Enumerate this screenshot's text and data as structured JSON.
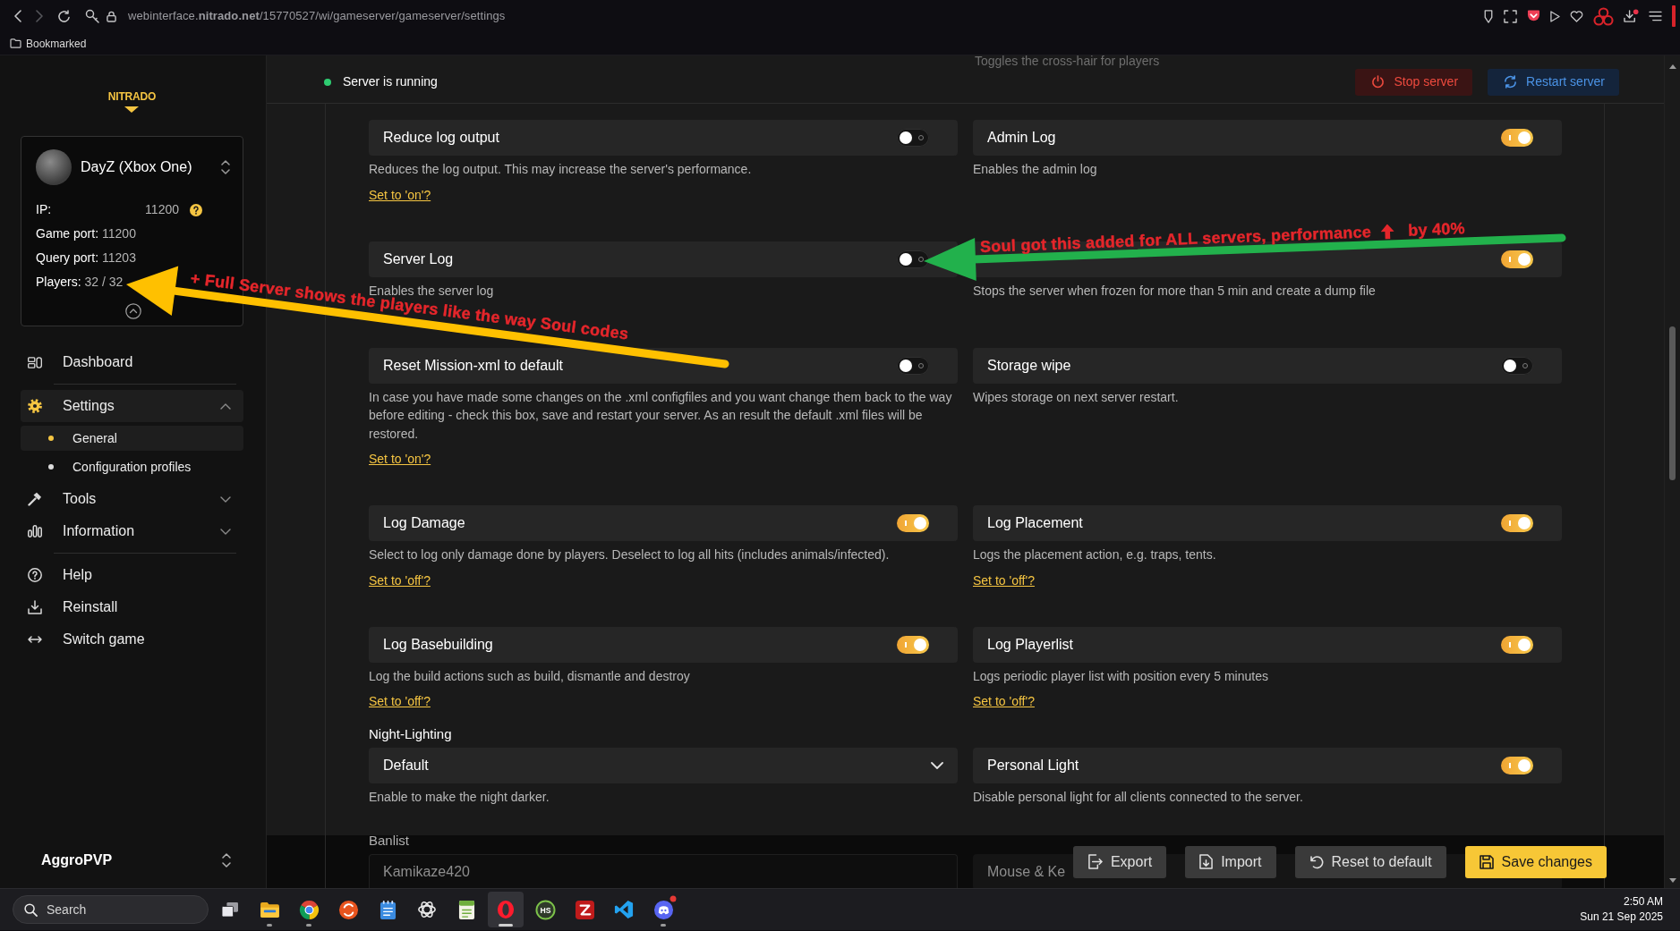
{
  "browser": {
    "url": "webinterface.**nitrado.net**/15770527/wi/gameserver/gameserver/settings",
    "bookmarks": [
      "Bookmarked"
    ]
  },
  "sidebar": {
    "logo": "NITRADO",
    "server": {
      "name": "DayZ (Xbox One)",
      "details": [
        {
          "kind": "help",
          "label": "IP:",
          "value": "11200"
        },
        {
          "kind": "plain",
          "label": "Game port:",
          "value": "11200"
        },
        {
          "kind": "plain",
          "label": "Query port:",
          "value": "11203"
        },
        {
          "kind": "plain",
          "label": "Players:",
          "value": "32 / 32"
        }
      ]
    },
    "nav": [
      {
        "items": [
          {
            "label": "Dashboard",
            "selected": false
          }
        ]
      },
      {
        "items": [
          {
            "label": "Settings",
            "selected": true,
            "expanded": true,
            "children": [
              {
                "label": "General",
                "selected": true
              },
              {
                "label": "Configuration profiles",
                "selected": false
              }
            ]
          },
          {
            "label": "Tools",
            "selected": false,
            "expanded": false
          },
          {
            "label": "Information",
            "selected": false,
            "expanded": false
          }
        ]
      },
      {
        "items": [
          {
            "label": "Help",
            "selected": false
          },
          {
            "label": "Reinstall",
            "selected": false
          },
          {
            "label": "Switch game",
            "selected": false
          }
        ]
      }
    ],
    "account": "AggroPVP"
  },
  "header": {
    "status": {
      "text": "Server is running",
      "running": true
    },
    "scrolled_description": "Toggles the cross-hair for players",
    "buttons": [
      {
        "kind": "stop",
        "label": "Stop server"
      },
      {
        "kind": "restart",
        "label": "Restart server"
      }
    ]
  },
  "settings": [
    {
      "cells": [
        {
          "kind": "toggle",
          "label": "Reduce log output",
          "on": false,
          "description": "Reduces the log output. This may increase the server's performance.",
          "link": "Set to 'on'?"
        },
        {
          "kind": "toggle",
          "label": "Admin Log",
          "on": true,
          "description": "Enables the admin log"
        }
      ]
    },
    {
      "cells": [
        {
          "kind": "toggle",
          "label": "Server Log",
          "on": false,
          "description": "Enables the server log"
        },
        {
          "kind": "toggle",
          "on": true,
          "description": "Stops the server when frozen for more than 5 min and create a dump file"
        }
      ]
    },
    {
      "cells": [
        {
          "kind": "toggle",
          "label": "Reset Mission-xml to default",
          "on": false,
          "description": "In case you have made some changes on the .xml configfiles and you want change them back to the way before editing - check this box, save and restart your server. As an result the default .xml files will be restored.",
          "link": "Set to 'on'?"
        },
        {
          "kind": "toggle",
          "label": "Storage wipe",
          "on": false,
          "description": "Wipes storage on next server restart."
        }
      ]
    },
    {
      "cells": [
        {
          "kind": "toggle",
          "label": "Log Damage",
          "on": true,
          "description": "Select to log only damage done by players. Deselect to log all hits (includes animals/infected).",
          "link": "Set to 'off'?"
        },
        {
          "kind": "toggle",
          "label": "Log Placement",
          "on": true,
          "description": "Logs the placement action, e.g. traps, tents.",
          "link": "Set to 'off'?"
        }
      ]
    },
    {
      "cells": [
        {
          "kind": "toggle",
          "label": "Log Basebuilding",
          "on": true,
          "description": "Log the build actions such as build, dismantle and destroy",
          "link": "Set to 'off'?"
        },
        {
          "kind": "toggle",
          "label": "Log Playerlist",
          "on": true,
          "description": "Logs periodic player list with position every 5 minutes",
          "link": "Set to 'off'?"
        }
      ]
    },
    {
      "cells": [
        {
          "kind": "select",
          "heading": "Night-Lighting",
          "value": "Default",
          "description": "Enable to make the night darker."
        },
        {
          "kind": "toggle",
          "label": "Personal Light",
          "on": true,
          "description": "Disable personal light for all clients connected to the server."
        }
      ]
    },
    {
      "cells": [
        {
          "kind": "list",
          "heading": "Banlist",
          "lines": [
            "Kamikaze420"
          ]
        },
        {
          "kind": "toggle",
          "label": "Mouse & Ke"
        }
      ]
    }
  ],
  "actions": [
    {
      "kind": "secondary",
      "label": "Export"
    },
    {
      "kind": "secondary",
      "label": "Import"
    },
    {
      "kind": "secondary",
      "label": "Reset to default"
    },
    {
      "kind": "primary",
      "label": "Save changes"
    }
  ],
  "taskbar": {
    "search": {
      "placeholder": "Search"
    },
    "apps": [
      {
        "running": false,
        "selected": false,
        "badge": false
      },
      {
        "running": true,
        "selected": false,
        "badge": false
      },
      {
        "running": true,
        "selected": false,
        "badge": false
      },
      {
        "running": false,
        "selected": false,
        "badge": false
      },
      {
        "running": false,
        "selected": false,
        "badge": false
      },
      {
        "running": false,
        "selected": false,
        "badge": false
      },
      {
        "running": false,
        "selected": false,
        "badge": false
      },
      {
        "running": true,
        "selected": true,
        "badge": false
      },
      {
        "running": false,
        "selected": false,
        "badge": false,
        "text": "HS"
      },
      {
        "running": false,
        "selected": false,
        "badge": false
      },
      {
        "running": false,
        "selected": false,
        "badge": false
      },
      {
        "running": true,
        "selected": false,
        "badge": true
      }
    ],
    "clock": {
      "time": "2:50 AM",
      "date": "Sun 21 Sep 2025"
    }
  },
  "annotations": [
    {
      "kind": "arrow",
      "color": "#ffc000",
      "text": "+ Full Server shows the players like the way Soul codes"
    },
    {
      "kind": "arrow",
      "color": "#22b14c",
      "text": "Soul got this added for ALL servers, performance",
      "text_after_icon": "by 40%"
    }
  ]
}
